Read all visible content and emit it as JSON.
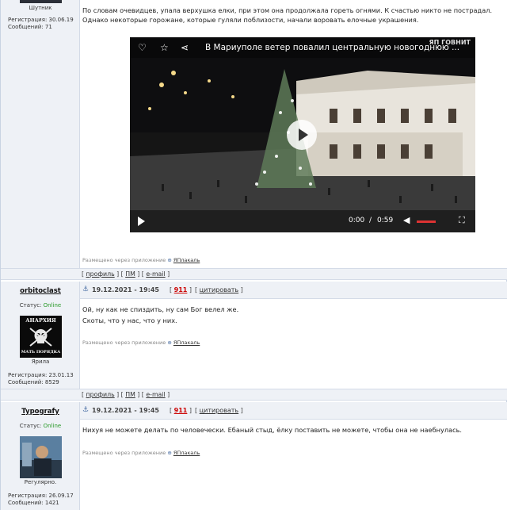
{
  "post1": {
    "rank": "Шутник",
    "reg": "Регистрация: 30.06.19",
    "msgs": "Сообщений: 71",
    "text": "По словам очевидцев, упала верхушка елки, при этом она продолжала гореть огнями. К счастью никто не пострадал. Однако некоторые горожане, которые гуляли поблизости, начали воровать елочные украшения.",
    "video": {
      "title": "В Мариуполе ветер повалил центральную новогоднюю ...",
      "logo": "ЯП ГОВНИТ",
      "time_current": "0:00",
      "time_sep": "/",
      "time_total": "0:59",
      "volume_fraction": 0.6,
      "icons": [
        "heart-icon",
        "star-icon",
        "share-icon",
        "play-icon",
        "volume-icon",
        "fullscreen-icon"
      ]
    },
    "via_prefix": "Размещено через приложение",
    "via_app": "ЯПлакаль"
  },
  "links": {
    "profile": "профиль",
    "pm": "ПМ",
    "email": "e-mail"
  },
  "post2": {
    "nick": "orbitoclast",
    "status_label": "Статус:",
    "status_value": "Online",
    "avatar_text_top": "АНАРХИЯ",
    "avatar_text_bottom": "МАТЬ ПОРЯДКА",
    "rank": "Ярила",
    "reg": "Регистрация: 23.01.13",
    "msgs": "Сообщений: 8529",
    "date": "19.12.2021 - 19:45",
    "number": "911",
    "quote": "цитировать",
    "line1": "Ой, ну как не спиздить, ну сам Бог велел же.",
    "line2": "Скоты, что у нас, что у них.",
    "via_prefix": "Размещено через приложение",
    "via_app": "ЯПлакаль"
  },
  "post3": {
    "nick": "Typografy",
    "status_label": "Статус:",
    "status_value": "Online",
    "rank": "Регулярно.",
    "reg": "Регистрация: 26.09.17",
    "msgs": "Сообщений: 1421",
    "date": "19.12.2021 - 19:45",
    "number": "911",
    "quote": "цитировать",
    "line1": "Нихуя не можете делать по человечески. Ебаный стыд, ёлку поставить не можете, чтобы она не наебнулась.",
    "via_prefix": "Размещено через приложение",
    "via_app": "ЯПлакаль"
  },
  "colors": {
    "online": "#2a9a2a",
    "post_number": "#cc0000",
    "panel": "#eef1f6",
    "video_progress": "#dd3333"
  }
}
